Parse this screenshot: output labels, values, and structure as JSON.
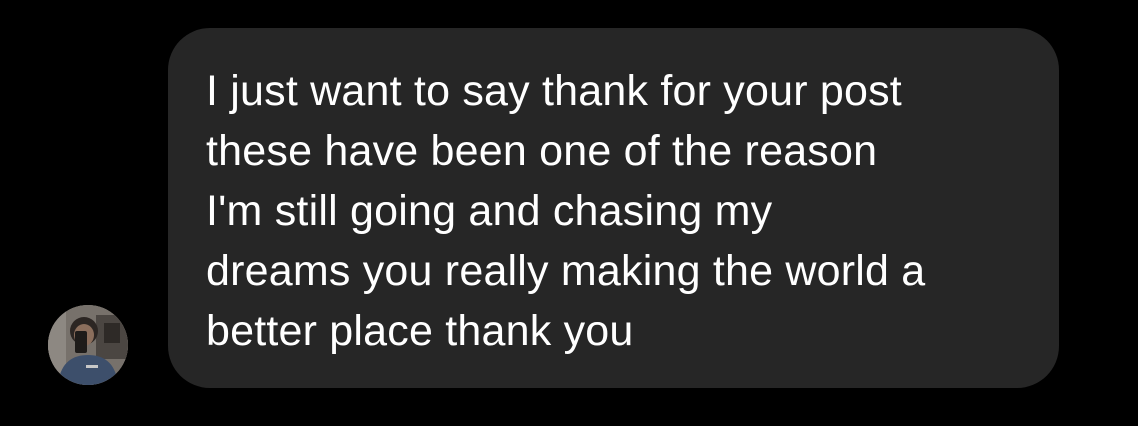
{
  "message": {
    "text": "I just want to say thank for your post\nthese have been one of the reason\nI'm still going and chasing my\ndreams you really making the world a\nbetter place thank you"
  },
  "sender": {
    "avatar_icon": "profile-photo-icon"
  },
  "colors": {
    "background": "#000000",
    "bubble": "#262626",
    "text": "#ffffff"
  }
}
